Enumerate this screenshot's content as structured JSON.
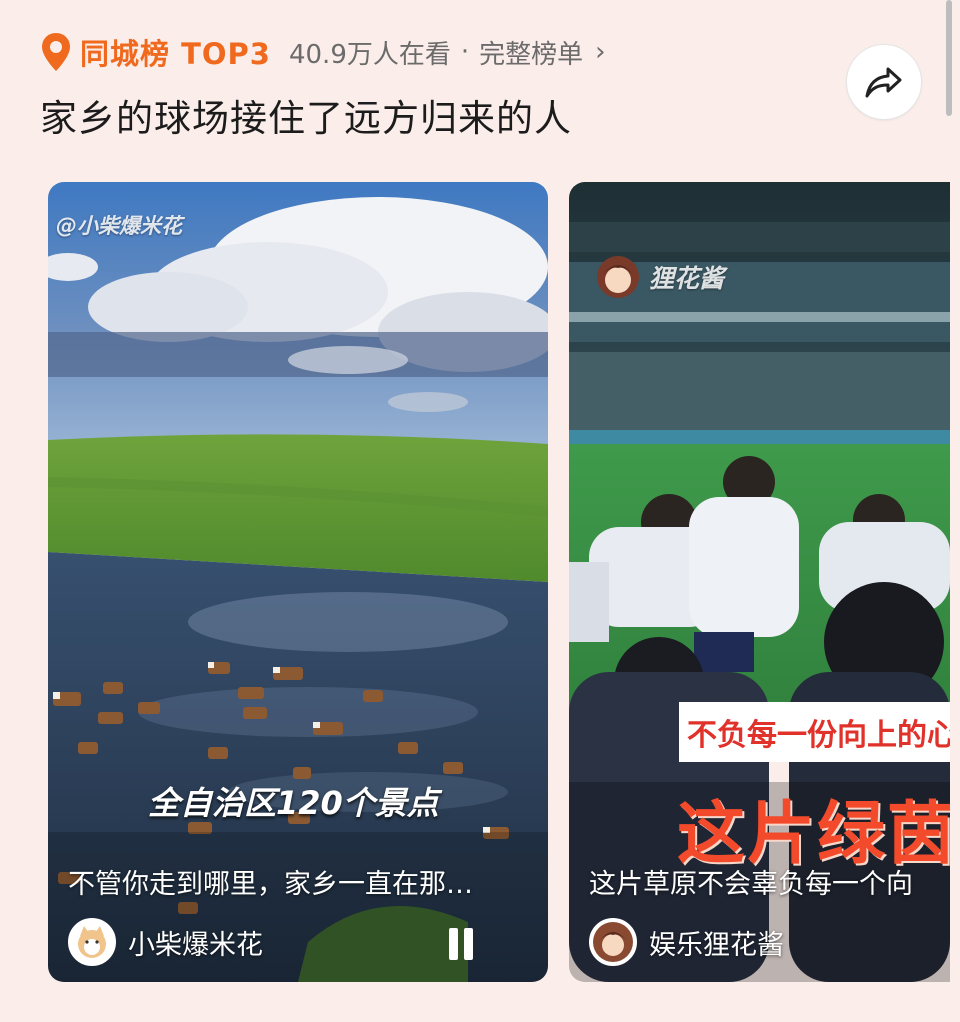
{
  "header": {
    "rank_title": "同城榜 TOP3",
    "viewers": "40.9万人在看",
    "dot": "·",
    "full_list": "完整榜单",
    "chevron": "›",
    "headline": "家乡的球场接住了远方归来的人"
  },
  "icons": {
    "location": "map-pin-icon",
    "share": "share-arrow-icon",
    "pause": "pause-icon"
  },
  "colors": {
    "accent": "#ef6a1e",
    "page_bg": "#fbeeea",
    "overlay_red": "#e0322a"
  },
  "cards": [
    {
      "watermark": "@小柴爆米花",
      "overlay_text": "全自治区120个景点",
      "caption": "不管你走到哪里，家乡一直在那…",
      "author": "小柴爆米花"
    },
    {
      "watermark": "狸花酱",
      "banner_text": "不负每一份向上的心",
      "big_text": "这片绿茵",
      "caption": "这片草原不会辜负每一个向",
      "author": "娱乐狸花酱"
    }
  ]
}
